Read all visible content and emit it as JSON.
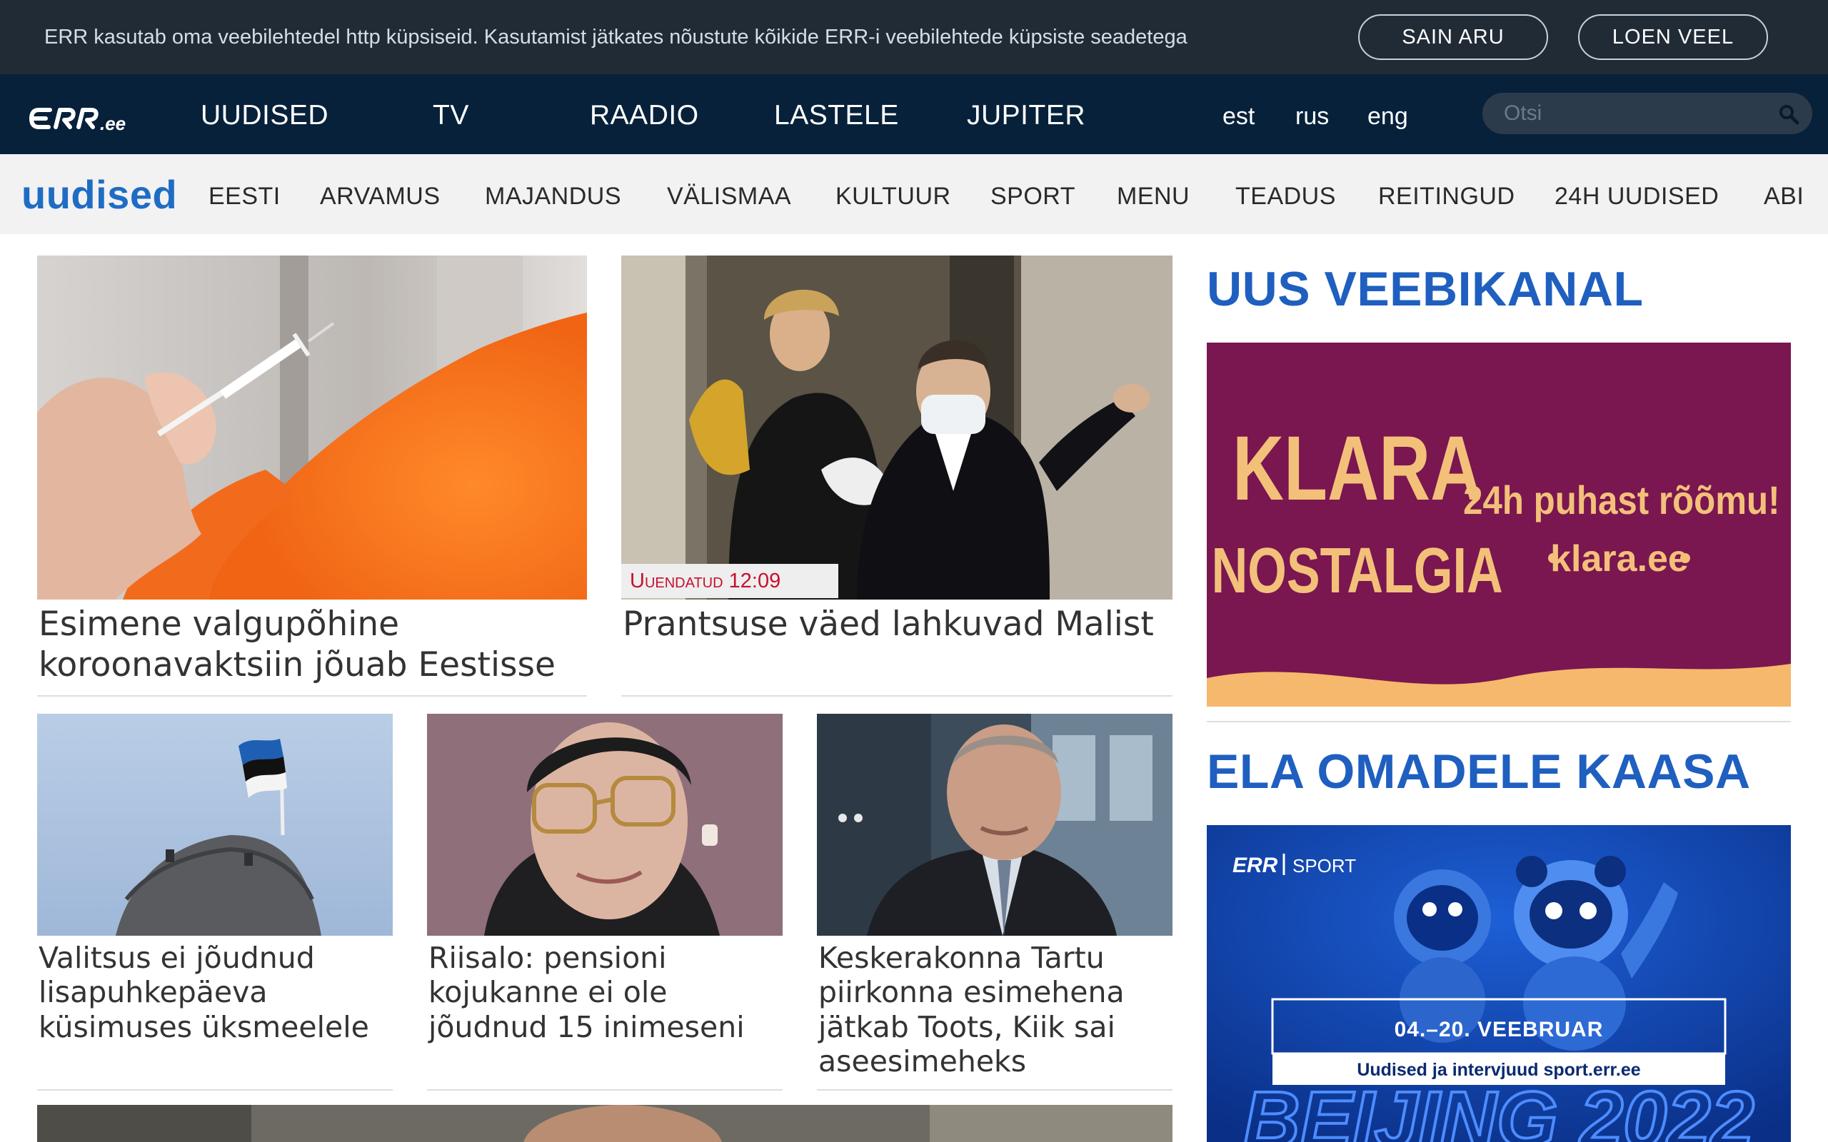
{
  "cookie": {
    "text": "ERR kasutab oma veebilehtedel http küpsiseid. Kasutamist jätkates nõustute kõikide ERR-i veebilehtede küpsiste seadetega",
    "accept_label": "SAIN ARU",
    "more_label": "LOEN VEEL"
  },
  "nav": {
    "logo_text": "ERR.ee",
    "items": [
      "UUDISED",
      "TV",
      "RAADIO",
      "LASTELE",
      "JUPITER"
    ],
    "languages": [
      "est",
      "rus",
      "eng"
    ],
    "search_placeholder": "Otsi"
  },
  "section_nav": {
    "brand": "uudised",
    "items": [
      "EESTI",
      "ARVAMUS",
      "MAJANDUS",
      "VÄLISMAA",
      "KULTUUR",
      "SPORT",
      "MENU",
      "TEADUS",
      "REITINGUD",
      "24H UUDISED",
      "ABI"
    ]
  },
  "articles": {
    "lead1_title": "Esimene valgupõhine koroonavaktsiin jõuab Eestisse",
    "lead2_title": "Prantsuse väed lahkuvad Malist",
    "lead2_badge": "Uuendatud 12:09",
    "small": [
      {
        "title": "Valitsus ei jõudnud lisapuhkepäeva küsimuses üksmeelele"
      },
      {
        "title": "Riisalo: pensioni kojukanne ei ole jõudnud 15 inimeseni"
      },
      {
        "title": "Keskerakonna Tartu piirkonna esimehena jätkab Toots, Kiik sai aseesimeheks"
      }
    ]
  },
  "sidebar": {
    "heading1": "UUS VEEBIKANAL",
    "klara_title_line1": "KLARA",
    "klara_title_line2": "NOSTALGIA",
    "klara_slogan": "24h puhast rõõmu!",
    "klara_url": "klara.ee",
    "heading2": "ELA OMADELE KAASA",
    "sport_brand": "SPORT",
    "sport_logo": "ERR",
    "sport_dates": "04.–20. VEEBRUAR",
    "sport_subtitle": "Uudised ja intervjuud sport.err.ee",
    "sport_big_text": "BEIJING 2022"
  },
  "colors": {
    "cookie_bg": "#212b36",
    "nav_bg": "#07213a",
    "section_bg": "#f2f2f2",
    "brand_blue": "#1f6cc4",
    "badge_red": "#c8102e",
    "klara_purple": "#7a1650",
    "klara_yellow": "#f3c07a",
    "sport_blue": "#0f3fb0"
  }
}
